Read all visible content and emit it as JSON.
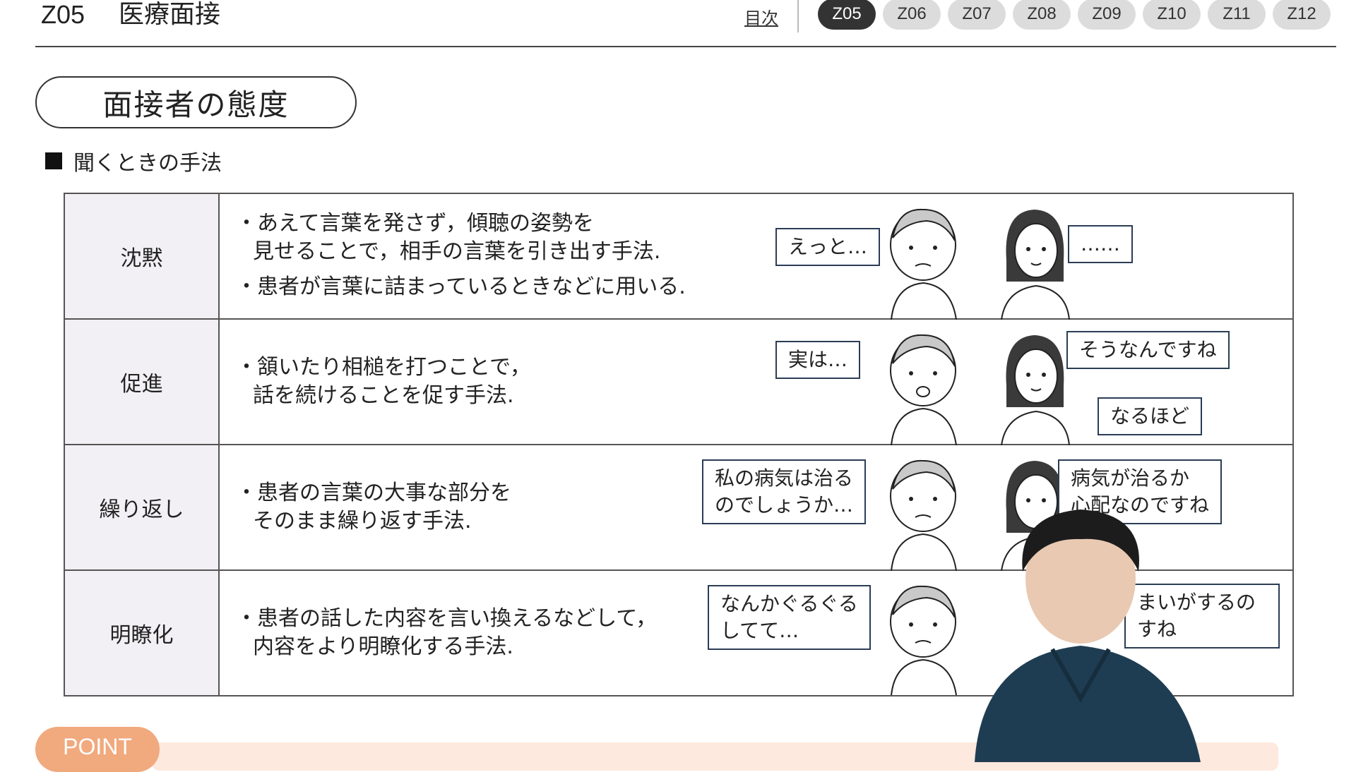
{
  "header": {
    "code": "Z05",
    "title": "医療面接",
    "toc_link": "目次",
    "tabs": [
      "Z05",
      "Z06",
      "Z07",
      "Z08",
      "Z09",
      "Z10",
      "Z11",
      "Z12"
    ],
    "active_tab": "Z05"
  },
  "section": {
    "title": "面接者の態度",
    "subheading": "聞くときの手法"
  },
  "rows": [
    {
      "label": "沈黙",
      "lines": [
        "・あえて言葉を発さず，傾聴の姿勢を",
        "見せることで，相手の言葉を引き出す手法.",
        "・患者が言葉に詰まっているときなどに用いる."
      ],
      "bubbles": [
        "えっと…",
        "……"
      ]
    },
    {
      "label": "促進",
      "lines": [
        "・頷いたり相槌を打つことで，",
        "話を続けることを促す手法."
      ],
      "bubbles": [
        "実は…",
        "そうなんですね",
        "なるほど"
      ]
    },
    {
      "label": "繰り返し",
      "lines": [
        "・患者の言葉の大事な部分を",
        "そのまま繰り返す手法."
      ],
      "bubbles": [
        "私の病気は治る",
        "のでしょうか…",
        "病気が治るか",
        "心配なのですね"
      ]
    },
    {
      "label": "明瞭化",
      "lines": [
        "・患者の話した内容を言い換えるなどして，",
        "内容をより明瞭化する手法."
      ],
      "bubbles": [
        "なんかぐるぐる",
        "してて…",
        "まいがするの",
        "すね"
      ]
    }
  ],
  "footer": {
    "point_label": "POINT"
  },
  "colors": {
    "active_tab": "#333333",
    "inactive_tab": "#dcdcdc",
    "point": "#f1a97e",
    "point_band": "#fde9dd",
    "bubble_border": "#2b3d55",
    "label_cell": "#f2f0f4"
  }
}
